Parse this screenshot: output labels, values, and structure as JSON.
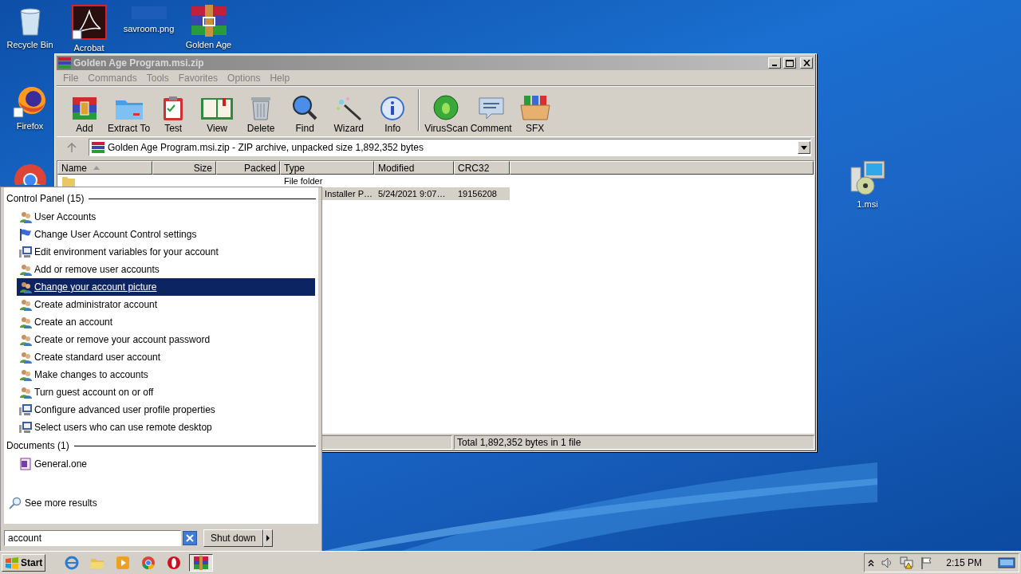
{
  "desktop_icons": [
    {
      "label": "Recycle Bin"
    },
    {
      "label": "Acrobat"
    },
    {
      "label": "savroom.png"
    },
    {
      "label": "Golden Age"
    },
    {
      "label": "Firefox"
    },
    {
      "label": "1.msi"
    }
  ],
  "window": {
    "title": "Golden Age Program.msi.zip",
    "menu": [
      "File",
      "Commands",
      "Tools",
      "Favorites",
      "Options",
      "Help"
    ],
    "toolbar": [
      "Add",
      "Extract To",
      "Test",
      "View",
      "Delete",
      "Find",
      "Wizard",
      "Info",
      "VirusScan",
      "Comment",
      "SFX"
    ],
    "address": "Golden Age Program.msi.zip - ZIP archive, unpacked size 1,892,352 bytes",
    "columns": [
      {
        "label": "Name",
        "sorted": true
      },
      {
        "label": "Size",
        "sorted": false
      },
      {
        "label": "Packed",
        "sorted": false
      },
      {
        "label": "Type",
        "sorted": false
      },
      {
        "label": "Modified",
        "sorted": false
      },
      {
        "label": "CRC32",
        "sorted": false
      }
    ],
    "rows": [
      {
        "kind": "folder",
        "type": "File folder",
        "selected": false
      },
      {
        "kind": "file",
        "type": "Installer P…",
        "modified": "5/24/2021 9:07…",
        "crc": "19156208",
        "selected": true
      }
    ],
    "status": "Total 1,892,352 bytes in 1 file"
  },
  "start_menu": {
    "groups": [
      {
        "title": "Control Panel (15)",
        "items": [
          {
            "label": "User Accounts",
            "kind": "users",
            "selected": false
          },
          {
            "label": "Change User Account Control settings",
            "kind": "flag",
            "selected": false
          },
          {
            "label": "Edit environment variables for your account",
            "kind": "computer",
            "selected": false
          },
          {
            "label": "Add or remove user accounts",
            "kind": "users",
            "selected": false
          },
          {
            "label": "Change your account picture",
            "kind": "users",
            "selected": true
          },
          {
            "label": "Create administrator account",
            "kind": "users",
            "selected": false
          },
          {
            "label": "Create an account",
            "kind": "users",
            "selected": false
          },
          {
            "label": "Create or remove your account password",
            "kind": "users",
            "selected": false
          },
          {
            "label": "Create standard user account",
            "kind": "users",
            "selected": false
          },
          {
            "label": "Make changes to accounts",
            "kind": "users",
            "selected": false
          },
          {
            "label": "Turn guest account on or off",
            "kind": "users",
            "selected": false
          },
          {
            "label": "Configure advanced user profile properties",
            "kind": "computer",
            "selected": false
          },
          {
            "label": "Select users who can use remote desktop",
            "kind": "computer",
            "selected": false
          }
        ]
      },
      {
        "title": "Documents (1)",
        "items": [
          {
            "label": "General.one",
            "kind": "note",
            "selected": false
          }
        ]
      }
    ],
    "more": "See more results",
    "search": {
      "value": "account"
    },
    "shutdown": "Shut down"
  },
  "taskbar": {
    "start": "Start",
    "apps": [
      {
        "active": false
      },
      {
        "active": false
      },
      {
        "active": false
      },
      {
        "active": false
      },
      {
        "active": false
      },
      {
        "active": true
      }
    ],
    "clock": "2:15 PM"
  }
}
